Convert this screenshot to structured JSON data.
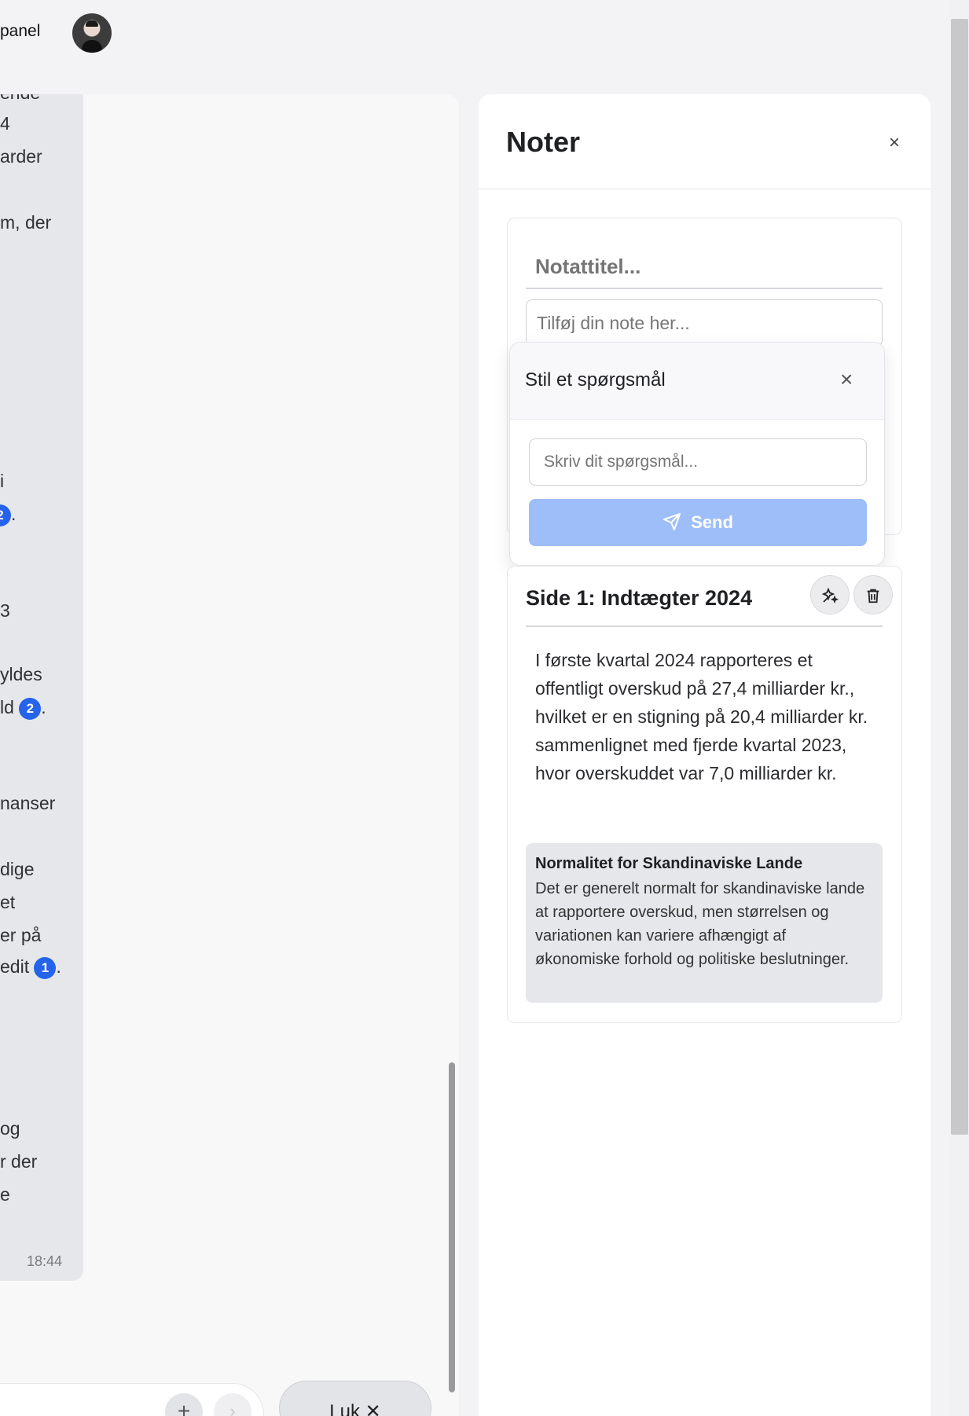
{
  "header": {
    "title_fragment": "panel"
  },
  "chat": {
    "fragments": [
      {
        "text": "ende",
        "citation": ""
      },
      {
        "text": "4",
        "citation": ""
      },
      {
        "text": "arder",
        "citation": ""
      },
      {
        "text": "m, der",
        "citation": ""
      },
      {
        "text": "i",
        "citation": ""
      },
      {
        "text": "",
        "citation": "2",
        "suffix": "."
      },
      {
        "text": "3",
        "citation": ""
      },
      {
        "text": "",
        "citation": ""
      },
      {
        "text": "yldes",
        "citation": ""
      },
      {
        "text": "ld ",
        "citation": "2",
        "suffix": "."
      },
      {
        "text": "nanser",
        "citation": ""
      },
      {
        "text": "dige",
        "citation": ""
      },
      {
        "text": "et",
        "citation": ""
      },
      {
        "text": "er på",
        "citation": ""
      },
      {
        "text": "edit ",
        "citation": "1",
        "suffix": "."
      },
      {
        "text": "og",
        "citation": ""
      },
      {
        "text": "r der",
        "citation": ""
      },
      {
        "text": "e",
        "citation": ""
      }
    ],
    "timestamp": "18:44",
    "close_label": "Luk ✕",
    "plus_label": "+",
    "send_label": "›"
  },
  "notes": {
    "title": "Noter",
    "close_label": "×",
    "title_placeholder": "Notattitel...",
    "body_placeholder": "Tilføj din note her...",
    "popup": {
      "title": "Stil et spørgsmål",
      "close_label": "×",
      "input_placeholder": "Skriv dit spørgsmål...",
      "send_label": "Send"
    },
    "card": {
      "title": "Side 1: Indtægter 2024",
      "text": "I første kvartal 2024 rapporteres et offentligt overskud på 27,4 milliarder kr., hvilket er en stigning på 20,4 milliarder kr. sammenlignet med fjerde kvartal 2023, hvor overskuddet var 7,0 milliarder kr.",
      "ai_title": "Normalitet for Skandinaviske Lande",
      "ai_text": "Det er generelt normalt for skandinaviske lande at rapportere overskud, men størrelsen og variationen kan variere afhængigt af økonomiske forhold og politiske beslutninger."
    }
  },
  "colors": {
    "accent": "#2563eb",
    "send_disabled": "#9dbef8"
  },
  "icons": [
    "sparkles-icon",
    "trash-icon",
    "send-icon",
    "close-icon",
    "plus-icon",
    "chevron-right-icon"
  ]
}
